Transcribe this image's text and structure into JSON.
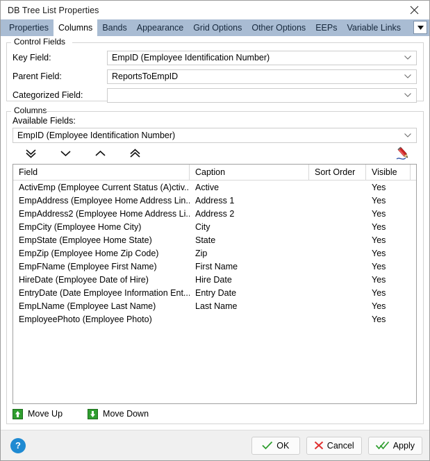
{
  "window": {
    "title": "DB Tree List Properties",
    "close_icon": "close-icon"
  },
  "tabs": {
    "items": [
      {
        "label": "Properties",
        "active": false
      },
      {
        "label": "Columns",
        "active": true
      },
      {
        "label": "Bands",
        "active": false
      },
      {
        "label": "Appearance",
        "active": false
      },
      {
        "label": "Grid Options",
        "active": false
      },
      {
        "label": "Other Options",
        "active": false
      },
      {
        "label": "EEPs",
        "active": false
      },
      {
        "label": "Variable Links",
        "active": false
      }
    ],
    "overflow_icon": "chevron-down-icon"
  },
  "control_fields": {
    "legend": "Control Fields",
    "rows": [
      {
        "label": "Key Field:",
        "value": "EmpID  (Employee Identification Number)"
      },
      {
        "label": "Parent Field:",
        "value": "ReportsToEmpID"
      },
      {
        "label": "Categorized Field:",
        "value": ""
      }
    ]
  },
  "columns_group": {
    "legend": "Columns",
    "available_fields_label": "Available Fields:",
    "available_fields_value": "EmpID  (Employee Identification Number)",
    "toolbar": [
      {
        "name": "move-all-down-button",
        "icon": "double-chevron-down-icon"
      },
      {
        "name": "move-down-button",
        "icon": "chevron-down-icon"
      },
      {
        "name": "move-up-button",
        "icon": "chevron-up-icon"
      },
      {
        "name": "move-all-up-button",
        "icon": "double-chevron-up-icon"
      }
    ],
    "edit_icon": "pencil-icon",
    "grid": {
      "headers": [
        "Field",
        "Caption",
        "Sort Order",
        "Visible"
      ],
      "rows": [
        {
          "field": "ActivEmp  (Employee Current Status (A)ctiv...",
          "caption": "Active",
          "sort_order": "",
          "visible": "Yes"
        },
        {
          "field": "EmpAddress  (Employee Home Address Lin...",
          "caption": "Address 1",
          "sort_order": "",
          "visible": "Yes"
        },
        {
          "field": "EmpAddress2  (Employee Home Address Li...",
          "caption": "Address 2",
          "sort_order": "",
          "visible": "Yes"
        },
        {
          "field": "EmpCity  (Employee Home City)",
          "caption": "City",
          "sort_order": "",
          "visible": "Yes"
        },
        {
          "field": "EmpState  (Employee Home State)",
          "caption": "State",
          "sort_order": "",
          "visible": "Yes"
        },
        {
          "field": "EmpZip  (Employee Home Zip Code)",
          "caption": "Zip",
          "sort_order": "",
          "visible": "Yes"
        },
        {
          "field": "EmpFName  (Employee First Name)",
          "caption": "First Name",
          "sort_order": "",
          "visible": "Yes"
        },
        {
          "field": "HireDate  (Employee Date of Hire)",
          "caption": "Hire Date",
          "sort_order": "",
          "visible": "Yes"
        },
        {
          "field": "EntryDate  (Date Employee Information Ent...",
          "caption": "Entry Date",
          "sort_order": "",
          "visible": "Yes"
        },
        {
          "field": "EmpLName  (Employee Last Name)",
          "caption": "Last Name",
          "sort_order": "",
          "visible": "Yes"
        },
        {
          "field": "EmployeePhoto  (Employee Photo)",
          "caption": "",
          "sort_order": "",
          "visible": "Yes"
        }
      ]
    },
    "move_up_label": "Move Up",
    "move_down_label": "Move Down",
    "move_up_icon": "green-arrow-up-icon",
    "move_down_icon": "green-arrow-down-icon"
  },
  "footer": {
    "help_label": "?",
    "ok_label": "OK",
    "cancel_label": "Cancel",
    "apply_label": "Apply",
    "ok_icon": "green-check-icon",
    "cancel_icon": "red-x-icon",
    "apply_icon": "green-double-check-icon"
  },
  "colors": {
    "tabstrip": "#a9bcd3",
    "accent_green": "#2f9e2f",
    "accent_red": "#e03030",
    "help_blue": "#1f8ad2",
    "pencil_red": "#c02020"
  }
}
